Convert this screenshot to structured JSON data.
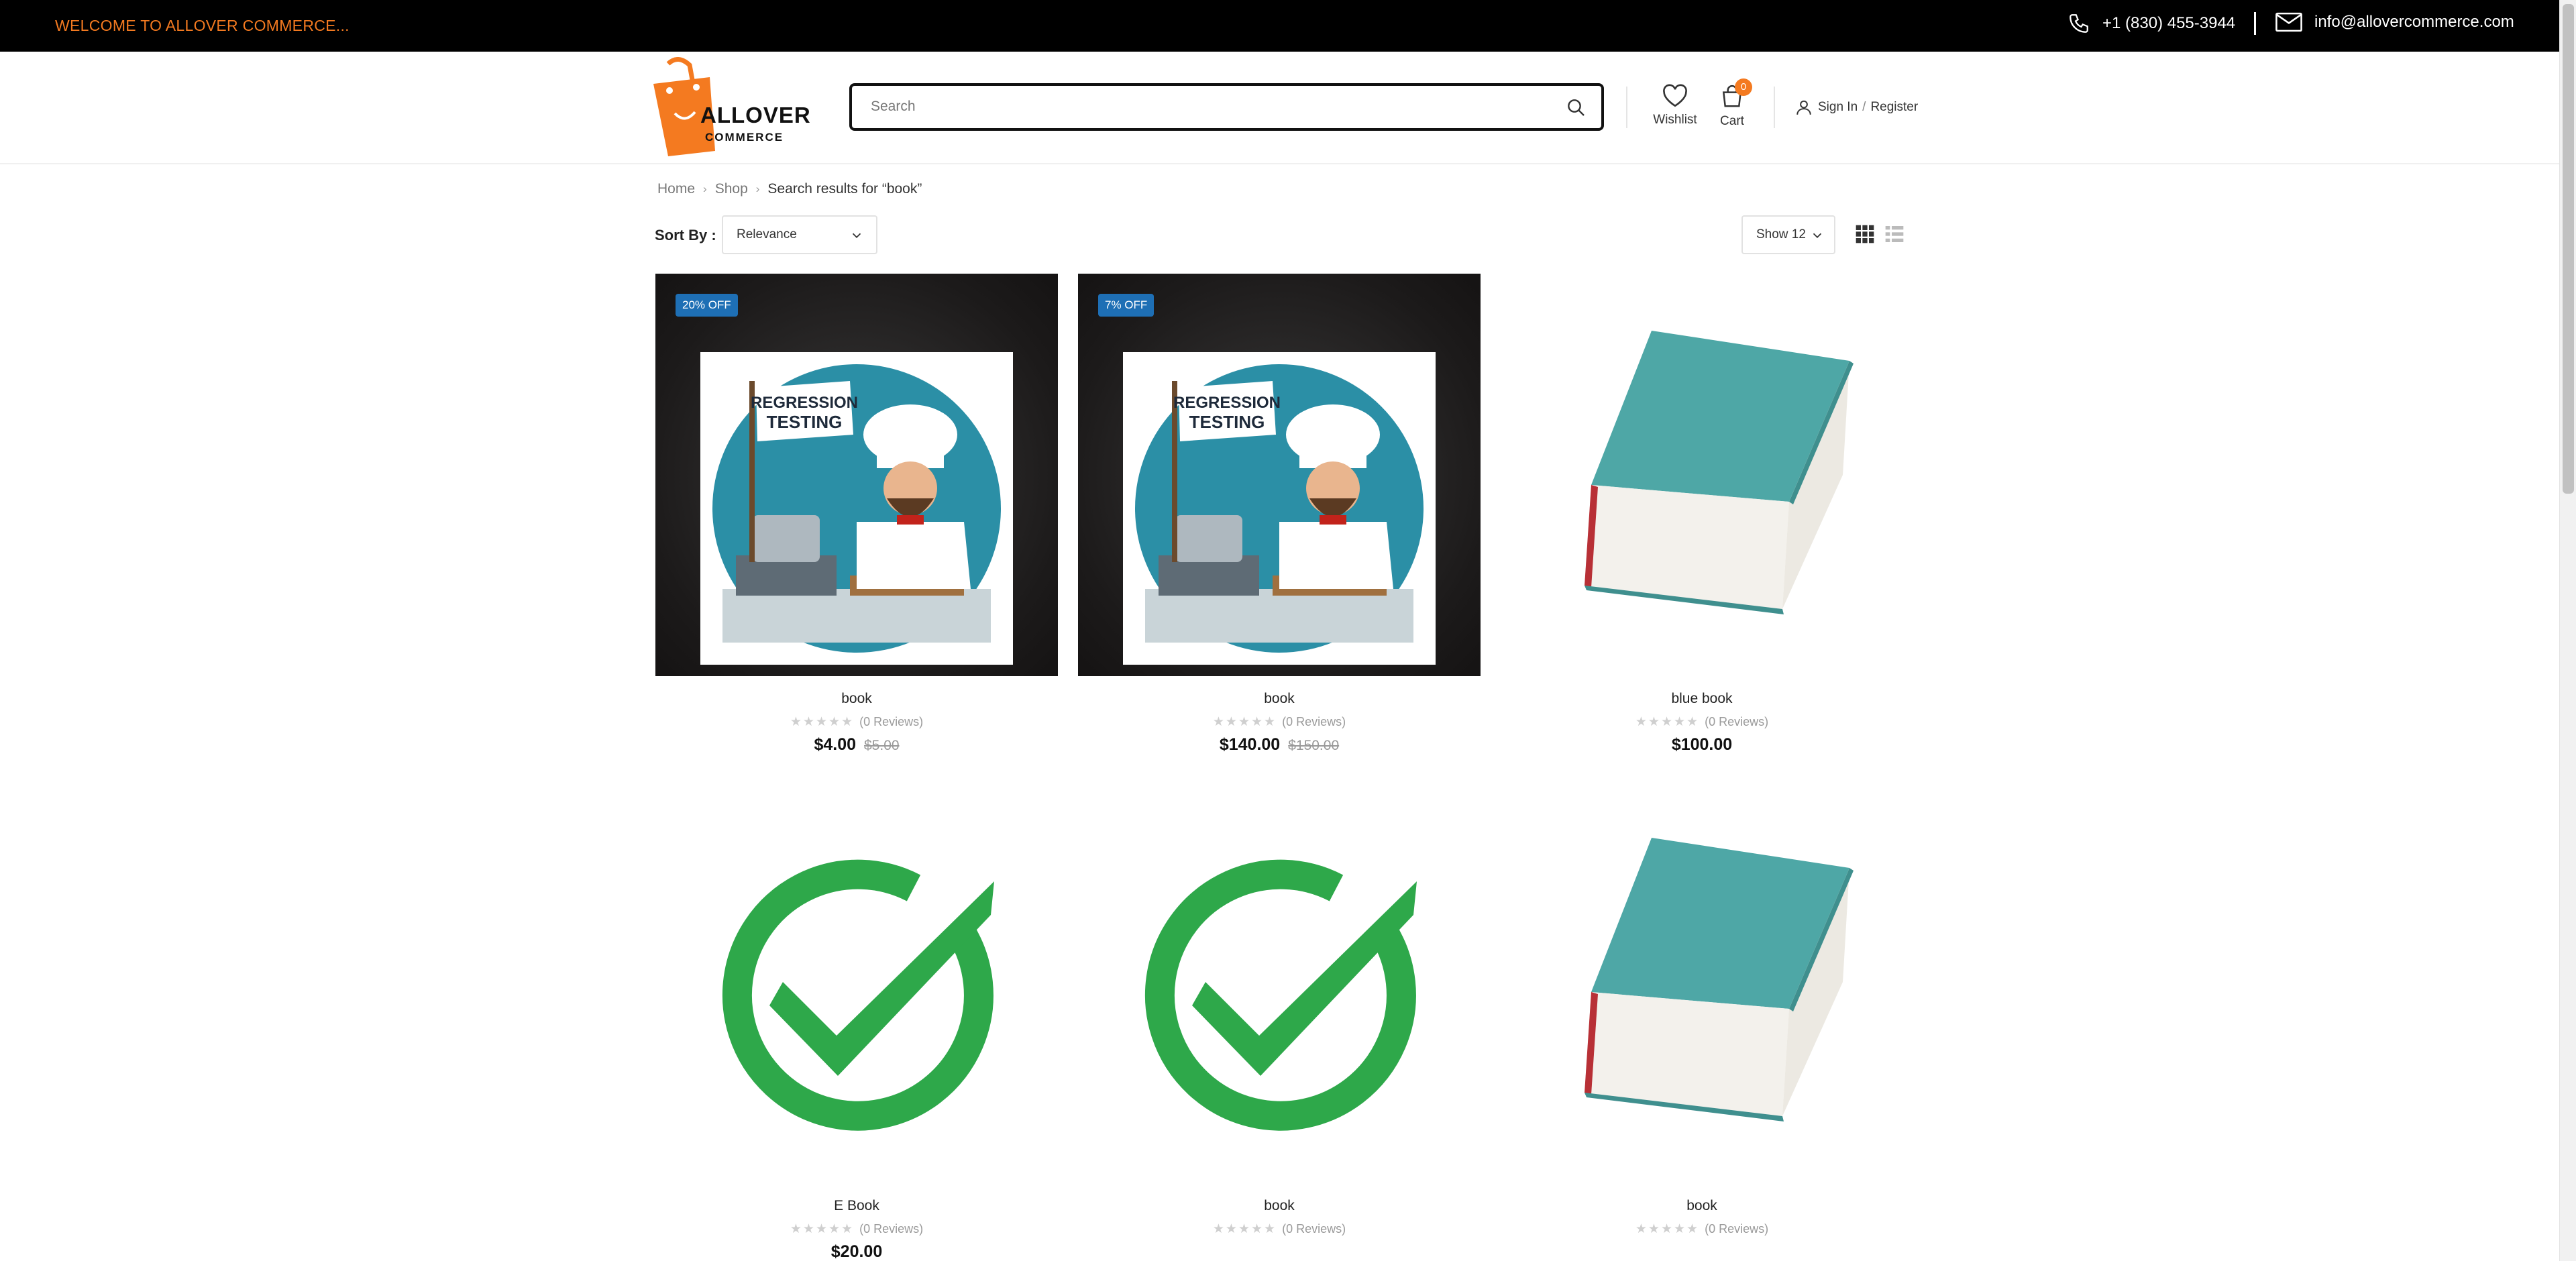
{
  "topbar": {
    "welcome": "WELCOME TO ALLOVER COMMERCE...",
    "phone": "+1 (830) 455-3944",
    "email": "info@allovercommerce.com"
  },
  "header": {
    "logo_word1": "ALLOVER",
    "logo_word2": "COMMERCE",
    "search_placeholder": "Search",
    "wishlist_label": "Wishlist",
    "cart_label": "Cart",
    "cart_count": "0",
    "sign_in": "Sign In",
    "separator": "/",
    "register": "Register"
  },
  "breadcrumb": {
    "home": "Home",
    "shop": "Shop",
    "current": "Search results for “book”"
  },
  "toolbar": {
    "sort_label": "Sort By :",
    "sort_value": "Relevance",
    "show_value": "Show 12"
  },
  "products": [
    {
      "name": "book",
      "badge": "20% OFF",
      "reviews": "(0 Reviews)",
      "price": "$4.00",
      "old_price": "$5.00",
      "image": "regression-testing-chef"
    },
    {
      "name": "book",
      "badge": "7% OFF",
      "reviews": "(0 Reviews)",
      "price": "$140.00",
      "old_price": "$150.00",
      "image": "regression-testing-chef"
    },
    {
      "name": "blue book",
      "reviews": "(0 Reviews)",
      "price": "$100.00",
      "image": "teal-hardcover-book"
    },
    {
      "name": "E Book",
      "reviews": "(0 Reviews)",
      "price": "$20.00",
      "image": "green-checkmark"
    },
    {
      "name": "book",
      "reviews": "(0 Reviews)",
      "image": "green-checkmark"
    },
    {
      "name": "book",
      "reviews": "(0 Reviews)",
      "image": "teal-hardcover-book"
    }
  ],
  "colors": {
    "accent": "#f47a20",
    "badge": "#1e6fb5",
    "topbar": "#000000"
  }
}
